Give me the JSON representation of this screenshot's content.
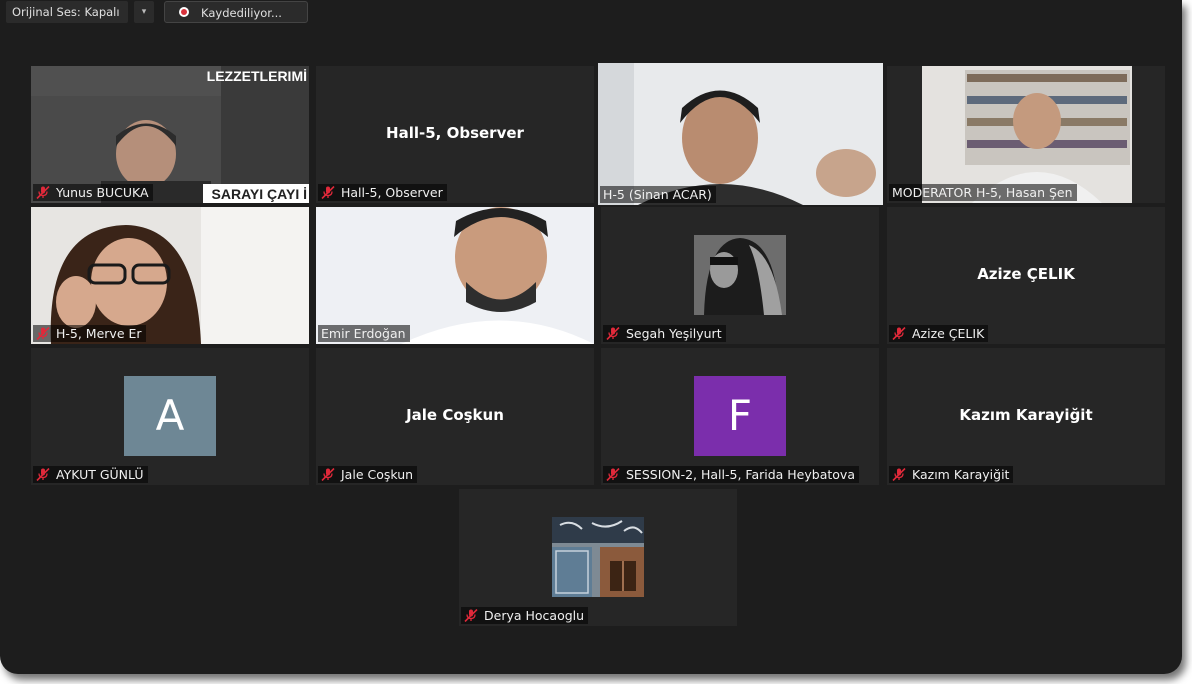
{
  "toolbar": {
    "original_sound_label": "Orijinal Ses: Kapalı",
    "recording_label": "Kaydediliyor..."
  },
  "tiles": [
    {
      "name": "Yunus BUCUKA",
      "muted": true,
      "type": "video",
      "overlay_text_top": "LEZZETLERIMİ",
      "overlay_text_bottom": "SARAYI ÇAYI İ"
    },
    {
      "name": "Hall-5, Observer",
      "center_name": "Hall-5, Observer",
      "muted": true,
      "type": "name"
    },
    {
      "name": "H-5 (Sinan ACAR)",
      "muted": false,
      "type": "video",
      "active_speaker": true
    },
    {
      "name": "MODERATOR H-5, Hasan Şen",
      "muted": false,
      "type": "video"
    },
    {
      "name": "H-5, Merve Er",
      "muted": true,
      "type": "video"
    },
    {
      "name": "Emir Erdoğan",
      "muted": false,
      "type": "video"
    },
    {
      "name": "Segah Yeşilyurt",
      "muted": true,
      "type": "photo"
    },
    {
      "name": "Azize ÇELIK",
      "center_name": "Azize ÇELIK",
      "muted": true,
      "type": "name"
    },
    {
      "name": "AYKUT GÜNLÜ",
      "muted": true,
      "type": "avatar",
      "avatar_letter": "A",
      "avatar_color": "#6e8795"
    },
    {
      "name": "Jale Coşkun",
      "center_name": "Jale Coşkun",
      "muted": true,
      "type": "name"
    },
    {
      "name": "SESSION-2, Hall-5, Farida Heybatova",
      "muted": true,
      "type": "avatar",
      "avatar_letter": "F",
      "avatar_color": "#7b2eac"
    },
    {
      "name": "Kazım Karayiğit",
      "center_name": "Kazım Karayiğit",
      "muted": true,
      "type": "name"
    },
    {
      "name": "Derya Hocaoglu",
      "muted": true,
      "type": "photo"
    }
  ],
  "colors": {
    "mute_icon": "#e0293a",
    "active_speaker_border": "#b9e05a",
    "background": "#1d1d1d"
  }
}
